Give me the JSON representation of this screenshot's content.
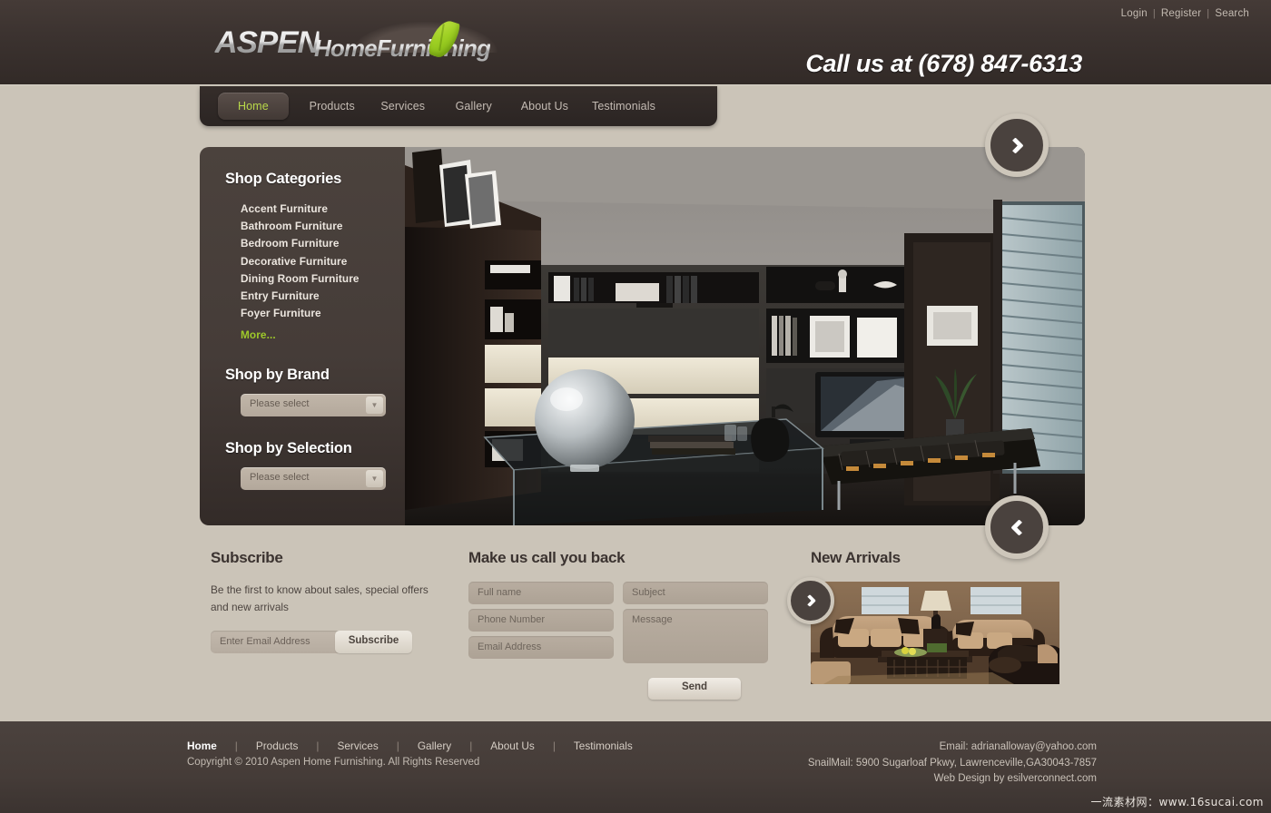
{
  "header": {
    "top_links": [
      {
        "label": "Login"
      },
      {
        "label": "Register"
      },
      {
        "label": "Search"
      }
    ],
    "separator": "|",
    "logo": {
      "primary": "ASPEN",
      "secondary": "HomeFurnishing"
    },
    "phone": "Call us at (678) 847-6313"
  },
  "nav": {
    "items": [
      {
        "label": "Home",
        "active": true
      },
      {
        "label": "Products",
        "active": false
      },
      {
        "label": "Services",
        "active": false
      },
      {
        "label": "Gallery",
        "active": false
      },
      {
        "label": "About Us",
        "active": false
      },
      {
        "label": "Testimonials",
        "active": false
      }
    ]
  },
  "sidebar": {
    "categories_title": "Shop Categories",
    "categories": [
      {
        "label": "Accent Furniture"
      },
      {
        "label": "Bathroom Furniture"
      },
      {
        "label": "Bedroom Furniture"
      },
      {
        "label": "Decorative Furniture"
      },
      {
        "label": "Dining Room Furniture"
      },
      {
        "label": "Entry Furniture"
      },
      {
        "label": "Foyer Furniture"
      }
    ],
    "more_label": "More...",
    "brand_title": "Shop by Brand",
    "brand_select_value": "Please select",
    "selection_title": "Shop by Selection",
    "selection_select_value": "Please select",
    "dropdown_arrow": "▼"
  },
  "hero": {
    "next_icon": "chevron-right",
    "prev_icon": "chevron-left"
  },
  "subscribe": {
    "title": "Subscribe",
    "description": "Be the first to know about sales, special offers and new arrivals",
    "email_placeholder": "Enter Email Address",
    "button_label": "Subscribe"
  },
  "callback": {
    "title": "Make us call you back",
    "fields": [
      {
        "placeholder": "Full name"
      },
      {
        "placeholder": "Phone Number"
      },
      {
        "placeholder": "Email Address"
      },
      {
        "placeholder": "Subject"
      },
      {
        "placeholder": "Message"
      }
    ],
    "send_label": "Send"
  },
  "arrivals": {
    "title": "New Arrivals",
    "next_icon": "chevron-right"
  },
  "footer": {
    "nav": [
      {
        "label": "Home"
      },
      {
        "label": "Products"
      },
      {
        "label": "Services"
      },
      {
        "label": "Gallery"
      },
      {
        "label": "About Us"
      },
      {
        "label": "Testimonials"
      }
    ],
    "separator": "|",
    "copyright": "Copyright © 2010 Aspen Home Furnishing. All Rights Reserved",
    "email": "Email: adrianalloway@yahoo.com",
    "snailmail": "SnailMail: 5900 Sugarloaf Pkwy, Lawrenceville,GA30043-7857",
    "credit": "Web Design by esilverconnect.com"
  },
  "watermark": "一流素材网：www.16sucai.com",
  "colors": {
    "header_dark": "#3c3330",
    "page_bg": "#cbc4b8",
    "accent_green": "#9ec92a",
    "sidebar_dark": "#453c38",
    "footer_dark": "#453c38"
  }
}
